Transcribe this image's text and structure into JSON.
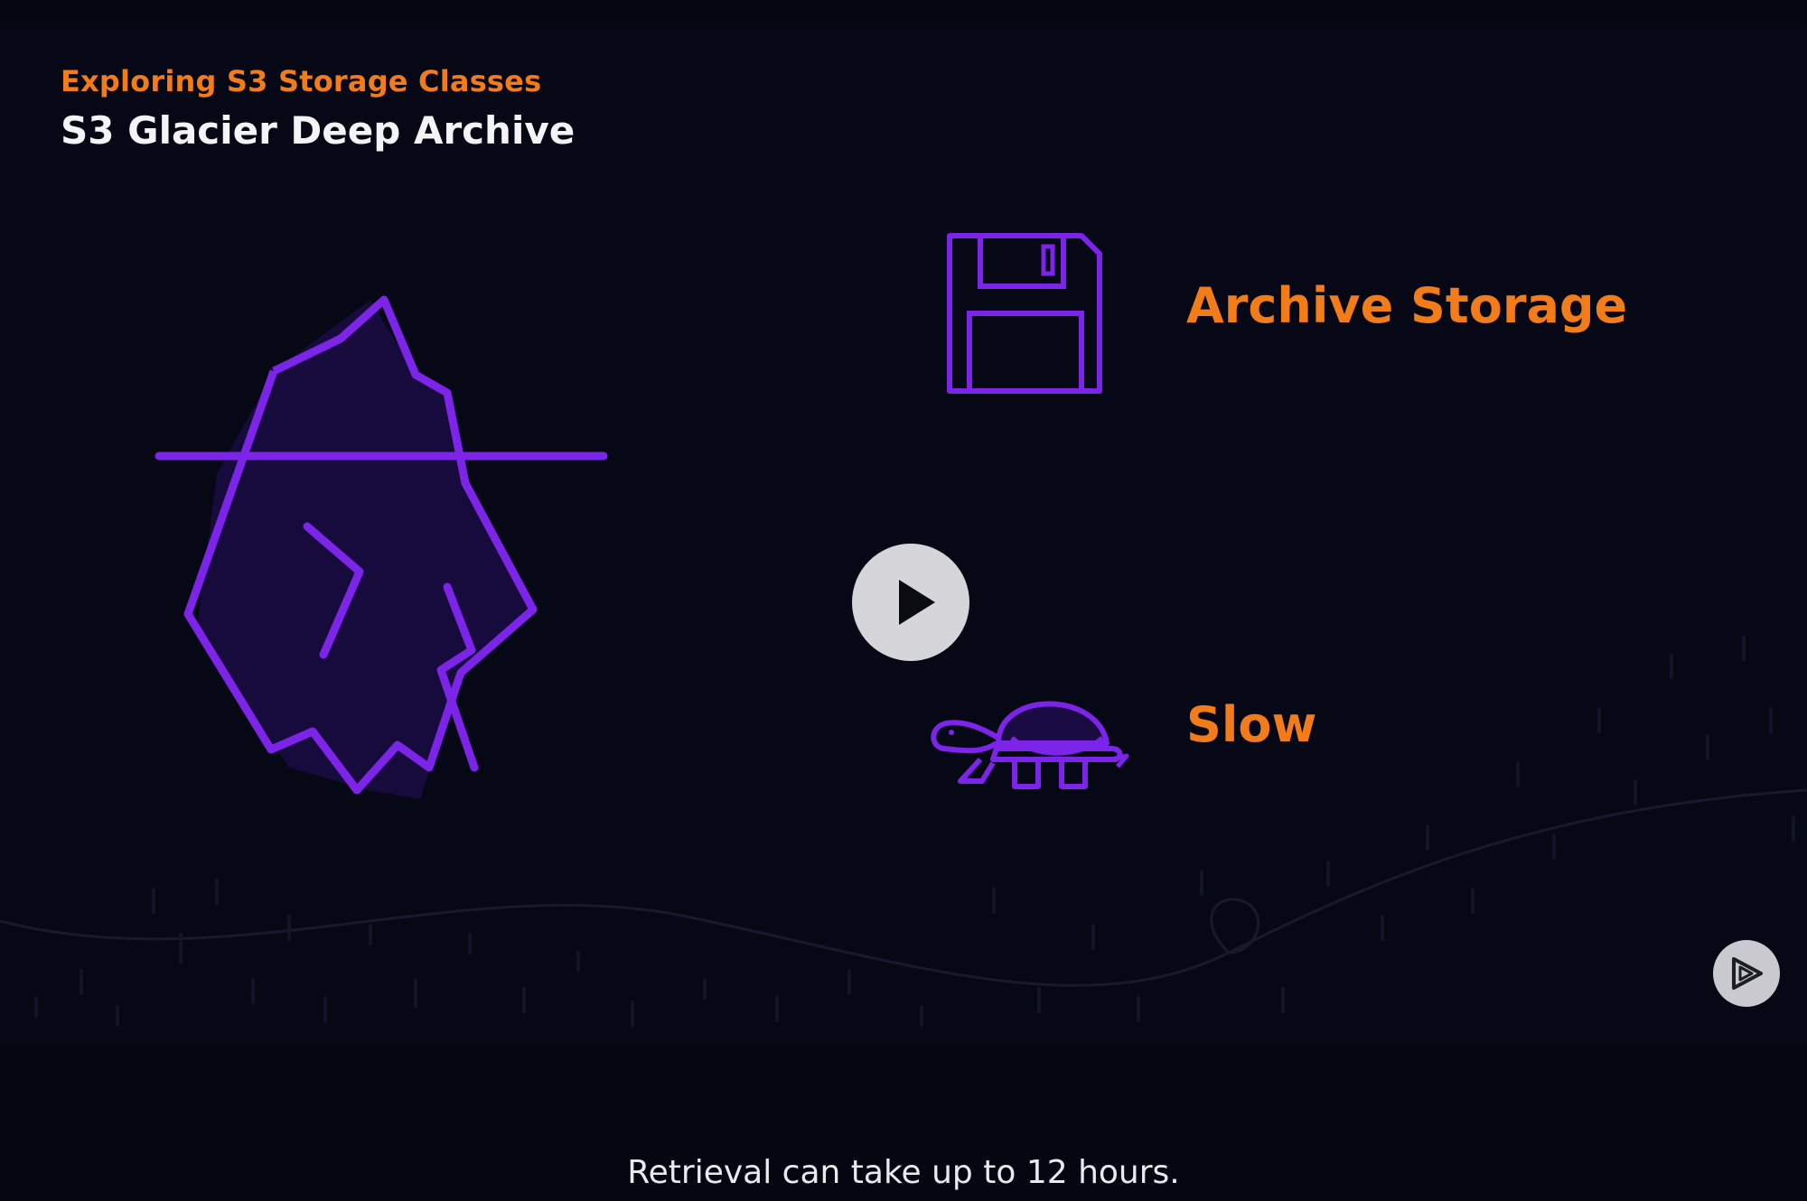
{
  "slide": {
    "eyebrow": "Exploring S3 Storage Classes",
    "title": "S3 Glacier Deep Archive",
    "features": [
      {
        "label": "Archive Storage",
        "icon": "floppy-disk-icon"
      },
      {
        "label": "Slow",
        "icon": "turtle-icon"
      }
    ],
    "illustration_icon": "iceberg-icon"
  },
  "player": {
    "play_icon": "play-icon",
    "brand_icon": "pluralsight-logo-icon"
  },
  "caption": "Retrieval can take up to 12 hours.",
  "colors": {
    "accent_orange": "#f27b1a",
    "accent_purple": "#7c24e8",
    "background": "#070815"
  }
}
